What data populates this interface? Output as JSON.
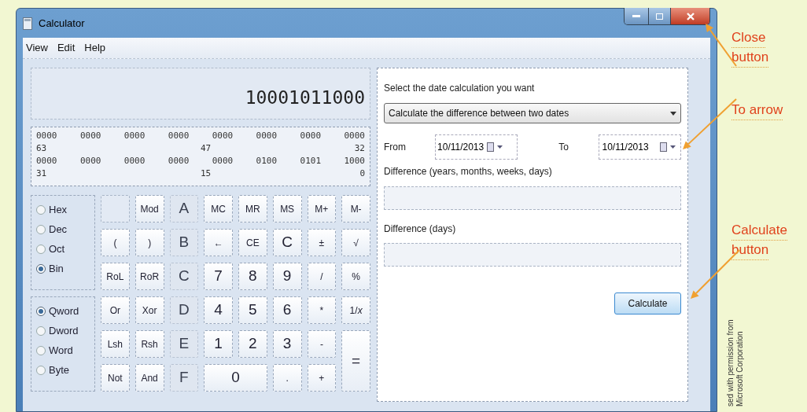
{
  "window": {
    "title": "Calculator"
  },
  "menu": [
    "View",
    "Edit",
    "Help"
  ],
  "display": {
    "value": "10001011000"
  },
  "bit_rows": [
    {
      "groups": [
        "0000",
        "0000",
        "0000",
        "0000",
        "0000",
        "0000",
        "0000",
        "0000"
      ],
      "labels": [
        "63",
        "47",
        "32"
      ]
    },
    {
      "groups": [
        "0000",
        "0000",
        "0000",
        "0000",
        "0000",
        "0100",
        "0101",
        "1000"
      ],
      "labels": [
        "31",
        "15",
        "0"
      ]
    }
  ],
  "radix": [
    {
      "label": "Hex",
      "selected": false
    },
    {
      "label": "Dec",
      "selected": false
    },
    {
      "label": "Oct",
      "selected": false
    },
    {
      "label": "Bin",
      "selected": true
    }
  ],
  "word_size": [
    {
      "label": "Qword",
      "selected": true
    },
    {
      "label": "Dword",
      "selected": false
    },
    {
      "label": "Word",
      "selected": false
    },
    {
      "label": "Byte",
      "selected": false
    }
  ],
  "keys": [
    {
      "kind": "blank"
    },
    {
      "kind": "key",
      "label": "Mod",
      "disabled": false
    },
    {
      "kind": "key",
      "label": "A",
      "disabled": true
    },
    {
      "kind": "key",
      "label": "MC",
      "disabled": false
    },
    {
      "kind": "key",
      "label": "MR",
      "disabled": false
    },
    {
      "kind": "key",
      "label": "MS",
      "disabled": false
    },
    {
      "kind": "key",
      "label": "M+",
      "disabled": false
    },
    {
      "kind": "key",
      "label": "M-",
      "disabled": false
    },
    {
      "kind": "key",
      "label": "(",
      "disabled": false
    },
    {
      "kind": "key",
      "label": ")",
      "disabled": false
    },
    {
      "kind": "key",
      "label": "B",
      "disabled": true
    },
    {
      "kind": "key",
      "label": "←",
      "disabled": false
    },
    {
      "kind": "key",
      "label": "CE",
      "disabled": false
    },
    {
      "kind": "key",
      "label": "C",
      "disabled": false
    },
    {
      "kind": "key",
      "label": "±",
      "disabled": false
    },
    {
      "kind": "key",
      "label": "√",
      "disabled": false
    },
    {
      "kind": "key",
      "label": "RoL",
      "disabled": false
    },
    {
      "kind": "key",
      "label": "RoR",
      "disabled": false
    },
    {
      "kind": "key",
      "label": "C",
      "disabled": true
    },
    {
      "kind": "key",
      "label": "7",
      "disabled": false
    },
    {
      "kind": "key",
      "label": "8",
      "disabled": false
    },
    {
      "kind": "key",
      "label": "9",
      "disabled": false
    },
    {
      "kind": "key",
      "label": "/",
      "disabled": false
    },
    {
      "kind": "key",
      "label": "%",
      "disabled": false
    },
    {
      "kind": "key",
      "label": "Or",
      "disabled": false
    },
    {
      "kind": "key",
      "label": "Xor",
      "disabled": false
    },
    {
      "kind": "key",
      "label": "D",
      "disabled": true
    },
    {
      "kind": "key",
      "label": "4",
      "disabled": false
    },
    {
      "kind": "key",
      "label": "5",
      "disabled": false
    },
    {
      "kind": "key",
      "label": "6",
      "disabled": false
    },
    {
      "kind": "key",
      "label": "*",
      "disabled": false
    },
    {
      "kind": "key",
      "label": "1/*x*",
      "disabled": false
    },
    {
      "kind": "key",
      "label": "Lsh",
      "disabled": false
    },
    {
      "kind": "key",
      "label": "Rsh",
      "disabled": false
    },
    {
      "kind": "key",
      "label": "E",
      "disabled": true
    },
    {
      "kind": "key",
      "label": "1",
      "disabled": false
    },
    {
      "kind": "key",
      "label": "2",
      "disabled": false
    },
    {
      "kind": "key",
      "label": "3",
      "disabled": false
    },
    {
      "kind": "key",
      "label": "-",
      "disabled": false
    },
    {
      "kind": "tall",
      "label": "=",
      "disabled": false
    },
    {
      "kind": "key",
      "label": "Not",
      "disabled": false
    },
    {
      "kind": "key",
      "label": "And",
      "disabled": false
    },
    {
      "kind": "key",
      "label": "F",
      "disabled": true
    },
    {
      "kind": "wide",
      "label": "0",
      "disabled": false
    },
    {
      "kind": "key",
      "label": ".",
      "disabled": false
    },
    {
      "kind": "key",
      "label": "+",
      "disabled": false
    }
  ],
  "date_panel": {
    "prompt": "Select the date calculation you want",
    "mode": "Calculate the difference between two dates",
    "from_label": "From",
    "from_value": "10/11/2013",
    "to_label": "To",
    "to_value": "10/11/2013",
    "difference_label": "Difference (years, months, weeks, days)",
    "days_label": "Difference (days)",
    "calculate_button": "Calculate"
  },
  "callouts": [
    {
      "lines": [
        "Close",
        "button"
      ]
    },
    {
      "lines": [
        "To arrow"
      ]
    },
    {
      "lines": [
        "Calculate",
        "button"
      ]
    }
  ],
  "credit": "sed with permission from Microsoft Corporation"
}
